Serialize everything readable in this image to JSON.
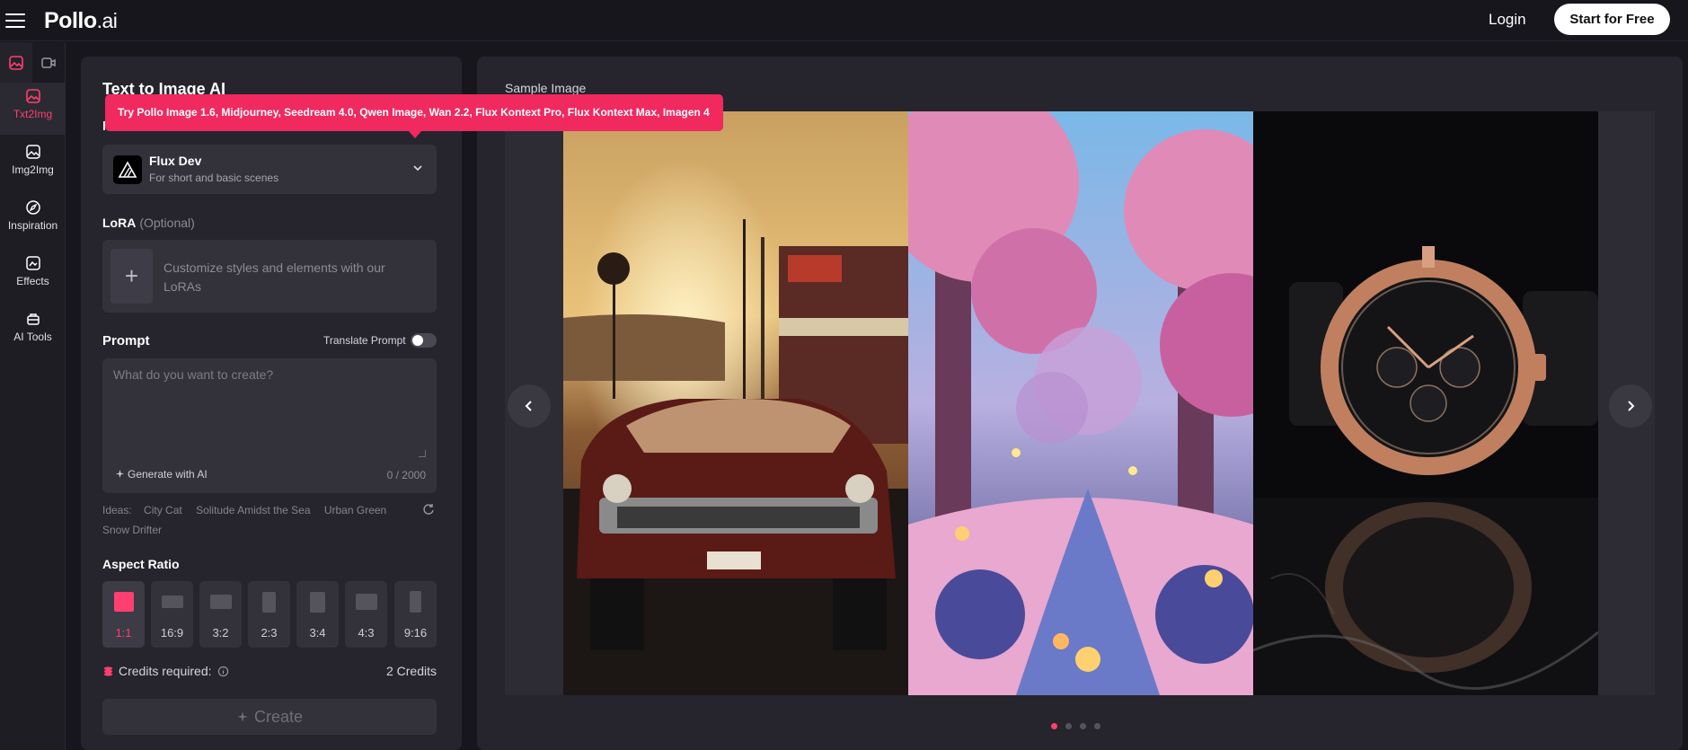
{
  "header": {
    "logo_main": "Pollo",
    "logo_suffix": ".ai",
    "login_label": "Login",
    "start_label": "Start for Free"
  },
  "rail": {
    "items": [
      {
        "label": "Txt2Img",
        "icon": "image-icon"
      },
      {
        "label": "Img2Img",
        "icon": "images-icon"
      },
      {
        "label": "Inspiration",
        "icon": "compass-icon"
      },
      {
        "label": "Effects",
        "icon": "effects-icon"
      },
      {
        "label": "AI Tools",
        "icon": "toolbox-icon"
      }
    ]
  },
  "panel": {
    "title": "Text to Image AI",
    "model_label": "Model",
    "tooltip": "Try Pollo Image 1.6, Midjourney, Seedream 4.0, Qwen Image, Wan 2.2, Flux Kontext Pro, Flux Kontext Max, Imagen 4",
    "model_name": "Flux Dev",
    "model_desc": "For short and basic scenes",
    "lora_label": "LoRA",
    "lora_optional": "(Optional)",
    "lora_plus": "+",
    "lora_placeholder": "Customize styles and elements with our LoRAs",
    "prompt_label": "Prompt",
    "translate_label": "Translate Prompt",
    "prompt_placeholder": "What do you want to create?",
    "generate_label": "Generate with AI",
    "char_count": "0 / 2000",
    "ideas_label": "Ideas:",
    "ideas": [
      "City Cat",
      "Solitude Amidst the Sea",
      "Urban Green",
      "Snow Drifter"
    ],
    "aspect_label": "Aspect Ratio",
    "aspects": [
      "1:1",
      "16:9",
      "3:2",
      "2:3",
      "3:4",
      "4:3",
      "9:16"
    ],
    "aspect_selected": "1:1",
    "credits_label": "Credits required:",
    "credits_value": "2 Credits",
    "create_label": "Create"
  },
  "sample": {
    "label": "Sample Image",
    "slides_total": 4,
    "active_slide": 1
  },
  "colors": {
    "accent": "#ff3f6f",
    "tooltip": "#f0295f",
    "panel": "#26252d",
    "field": "#33323b"
  }
}
